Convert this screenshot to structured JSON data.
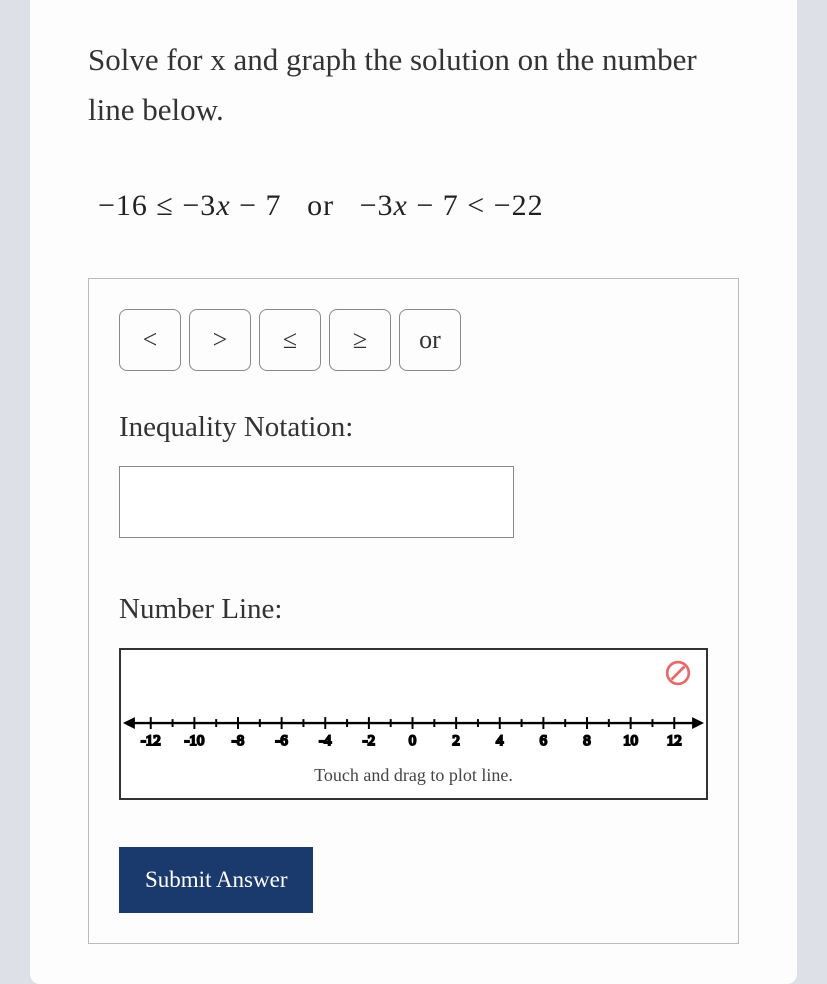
{
  "question": "Solve for x and graph the solution on the number line below.",
  "question_prefix": "Solve for ",
  "question_var": "x",
  "question_suffix": " and graph the solution on the number line below.",
  "equation": {
    "part1_a": "−16 ≤ −3",
    "part1_var": "x",
    "part1_b": " − 7",
    "or": "or",
    "part2_a": "−3",
    "part2_var": "x",
    "part2_b": " − 7 < −22"
  },
  "symbols": {
    "lt": "<",
    "gt": ">",
    "le": "≤",
    "ge": "≥",
    "or": "or"
  },
  "labels": {
    "inequality": "Inequality Notation:",
    "numberline": "Number Line:",
    "hint": "Touch and drag to plot line.",
    "submit": "Submit Answer"
  },
  "input": {
    "value": ""
  },
  "numberline": {
    "min": -12,
    "max": 12,
    "step": 2,
    "ticks": [
      "-12",
      "-10",
      "-8",
      "-6",
      "-4",
      "-2",
      "0",
      "2",
      "4",
      "6",
      "8",
      "10",
      "12"
    ]
  }
}
